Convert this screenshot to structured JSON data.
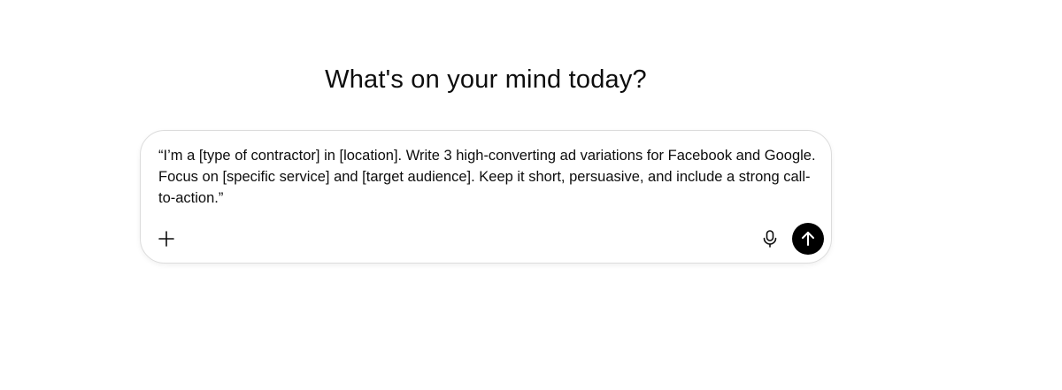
{
  "heading": "What's on your mind today?",
  "composer": {
    "prompt": "“I’m a [type of contractor] in [location]. Write 3 high-converting ad variations for Facebook and Google. Focus on [specific service] and [target audience]. Keep it short, persuasive, and include a strong call-to-action.”",
    "icons": {
      "attach": "plus-icon",
      "voice": "microphone-icon",
      "send": "arrow-up-icon"
    },
    "colors": {
      "send_button_bg": "#000000",
      "border": "#dcdcdc",
      "text": "#0d0d0d"
    }
  }
}
